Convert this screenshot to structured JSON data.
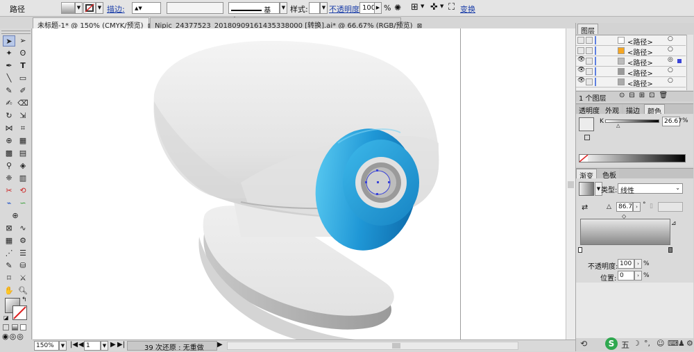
{
  "control_bar": {
    "selection_type": "路径",
    "stroke_label": "描边:",
    "stroke_profile": "基本",
    "style_label": "样式:",
    "opacity_label": "不透明度:",
    "opacity_value": "100",
    "opacity_unit": "%",
    "transform_label": "变换"
  },
  "tabs": [
    {
      "label": "未标题-1* @ 150% (CMYK/预览)",
      "active": true
    },
    {
      "label": "Nipic_24377523_20180909161435338000 [转换].ai* @ 66.67% (RGB/预览)",
      "active": false
    }
  ],
  "status_bar": {
    "zoom": "150%",
    "page": "1",
    "undo_text": "39 次还原 : 无重做"
  },
  "layers_panel": {
    "title": "图层",
    "rows": [
      {
        "label": "<路径>",
        "eye": false
      },
      {
        "label": "<路径>",
        "eye": false
      },
      {
        "label": "<路径>",
        "eye": true
      },
      {
        "label": "<路径>",
        "eye": true
      },
      {
        "label": "<路径>",
        "eye": true
      }
    ],
    "footer": "1 个图层"
  },
  "color_panel": {
    "tabs": [
      "透明度",
      "外观",
      "描边",
      "颜色"
    ],
    "active_tab": "颜色",
    "channel_label": "K",
    "channel_value": "26.67",
    "channel_unit": "%"
  },
  "gradient_panel": {
    "tabs": [
      "渐变",
      "色板"
    ],
    "active_tab": "渐变",
    "type_label": "类型:",
    "type_value": "线性",
    "angle_value": "86.75",
    "opacity_label": "不透明度:",
    "opacity_value": "100",
    "opacity_unit": "%",
    "location_label": "位置:",
    "location_value": "0",
    "location_unit": "%"
  },
  "taskbar": {
    "ime_label": "五"
  },
  "colors": {
    "accent_blue": "#1ea1dc",
    "link_blue": "#1b3ea8",
    "selection_blue": "#3a44d8"
  }
}
